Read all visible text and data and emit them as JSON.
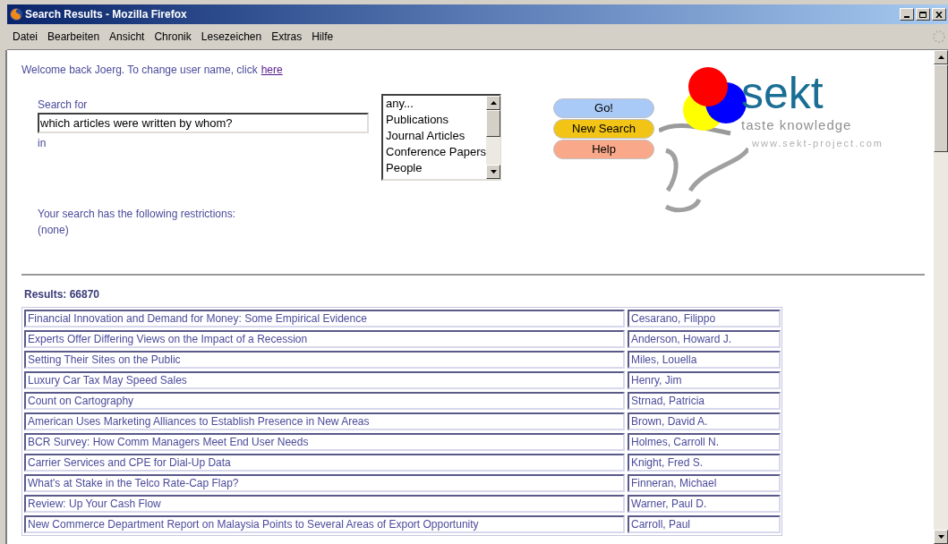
{
  "window": {
    "title": "Search Results - Mozilla Firefox"
  },
  "menu": [
    "Datei",
    "Bearbeiten",
    "Ansicht",
    "Chronik",
    "Lesezeichen",
    "Extras",
    "Hilfe"
  ],
  "welcome": {
    "text": "Welcome back Joerg. To change user name, click",
    "link": "here"
  },
  "search": {
    "label": "Search for",
    "value": "which articles were written by whom?",
    "in_label": "in"
  },
  "categories": [
    "any...",
    "Publications",
    "Journal Articles",
    "Conference Papers",
    "People"
  ],
  "buttons": [
    {
      "label": "Go!",
      "color": "#a9c9f6"
    },
    {
      "label": "New Search",
      "color": "#f2c416"
    },
    {
      "label": "Help",
      "color": "#f9a889"
    }
  ],
  "logo": {
    "name": "sekt",
    "tagline": "taste knowledge",
    "url": "www.sekt-project.com"
  },
  "restrictions": {
    "heading": "Your search has the following restrictions:",
    "value": "(none)"
  },
  "results": {
    "label": "Results: 66870",
    "rows": [
      {
        "title": "Financial Innovation and Demand for Money: Some Empirical Evidence",
        "author": "Cesarano, Filippo"
      },
      {
        "title": "Experts Offer Differing Views on the Impact of a Recession",
        "author": "Anderson, Howard J."
      },
      {
        "title": "Setting Their Sites on the Public",
        "author": "Miles, Louella"
      },
      {
        "title": "Luxury Car Tax May Speed Sales",
        "author": "Henry, Jim"
      },
      {
        "title": "Count on Cartography",
        "author": "Strnad, Patricia"
      },
      {
        "title": "American Uses Marketing Alliances to Establish Presence in New Areas",
        "author": "Brown, David A."
      },
      {
        "title": "BCR Survey: How Comm Managers Meet End User Needs",
        "author": "Holmes, Carroll N."
      },
      {
        "title": "Carrier Services and CPE for Dial-Up Data",
        "author": "Knight, Fred S."
      },
      {
        "title": "What's at Stake in the Telco Rate-Cap Flap?",
        "author": "Finneran, Michael"
      },
      {
        "title": "Review: Up Your Cash Flow",
        "author": "Warner, Paul D."
      },
      {
        "title": "New Commerce Department Report on Malaysia Points to Several Areas of Export Opportunity",
        "author": "Carroll, Paul"
      }
    ]
  }
}
